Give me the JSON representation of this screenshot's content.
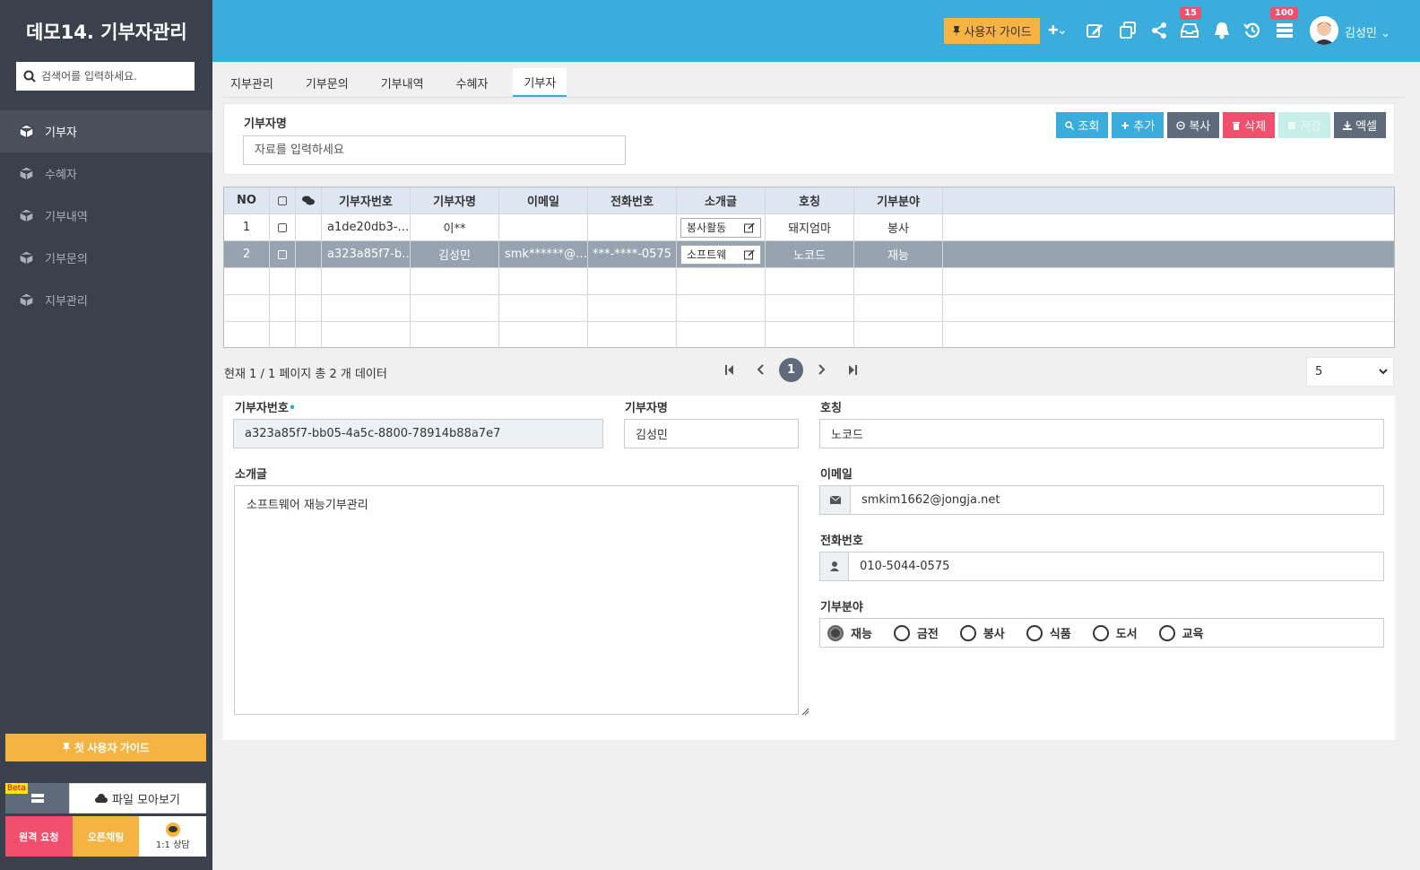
{
  "app": {
    "title": "데모14. 기부자관리"
  },
  "sidebar": {
    "search_placeholder": "검색어를 입력하세요.",
    "items": [
      {
        "label": "기부자"
      },
      {
        "label": "수혜자"
      },
      {
        "label": "기부내역"
      },
      {
        "label": "기부문의"
      },
      {
        "label": "지부관리"
      }
    ],
    "first_guide": "첫 사용자 가이드",
    "beta": "Beta",
    "file_view": "파일 모아보기",
    "remote": "원격 요청",
    "open_chat": "오픈채팅",
    "consult": "1:1 상담"
  },
  "header": {
    "user_guide": "사용자 가이드",
    "inbox_badge": "15",
    "list_badge": "100",
    "user_name": "김성민"
  },
  "tabs": [
    {
      "label": "지부관리"
    },
    {
      "label": "기부문의"
    },
    {
      "label": "기부내역"
    },
    {
      "label": "수혜자"
    },
    {
      "label": "기부자"
    }
  ],
  "search": {
    "label": "기부자명",
    "placeholder": "자료를 입력하세요",
    "buttons": {
      "search": "조회",
      "add": "추가",
      "copy": "복사",
      "delete": "삭제",
      "save": "저장",
      "excel": "엑셀"
    }
  },
  "grid": {
    "headers": {
      "no": "NO",
      "id": "기부자번호",
      "name": "기부자명",
      "email": "이메일",
      "phone": "전화번호",
      "intro": "소개글",
      "title": "호칭",
      "field": "기부분야"
    },
    "rows": [
      {
        "no": "1",
        "id": "a1de20db3-…",
        "name": "이**",
        "email": "",
        "phone": "",
        "intro": "봉사활동",
        "title": "돼지엄마",
        "field": "봉사"
      },
      {
        "no": "2",
        "id": "a323a85f7-b…",
        "name": "김성민",
        "email": "smk******@…",
        "phone": "***-****-0575",
        "intro": "소프트웨",
        "title": "노코드",
        "field": "재능"
      }
    ]
  },
  "pager": {
    "info": "현재 1 / 1 페이지 총 2 개 데이터",
    "current": "1",
    "page_size": "5"
  },
  "form": {
    "id_label": "기부자번호",
    "id_required": "•",
    "id_value": "a323a85f7-bb05-4a5c-8800-78914b88a7e7",
    "name_label": "기부자명",
    "name_value": "김성민",
    "title_label": "호칭",
    "title_value": "노코드",
    "intro_label": "소개글",
    "intro_value": "소프트웨어 재능기부관리",
    "email_label": "이메일",
    "email_value": "smkim1662@jongja.net",
    "phone_label": "전화번호",
    "phone_value": "010-5044-0575",
    "field_label": "기부분야",
    "field_options": [
      "재능",
      "금전",
      "봉사",
      "식품",
      "도서",
      "교육"
    ],
    "field_selected": "재능"
  }
}
